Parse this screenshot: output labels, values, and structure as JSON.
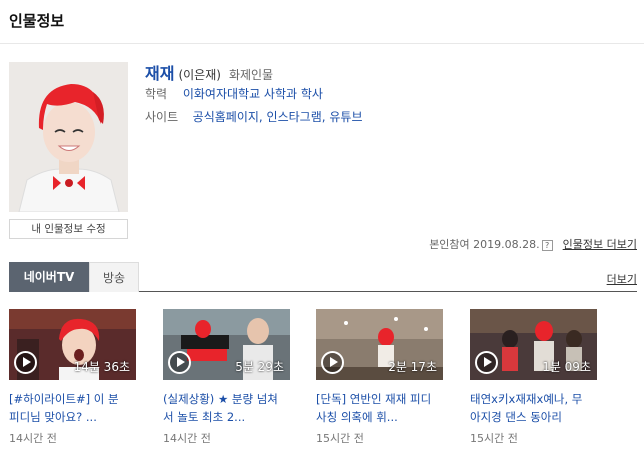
{
  "header": {
    "title": "인물정보"
  },
  "profile": {
    "name": "재재",
    "real_name": "(이은재)",
    "category": "화제인물",
    "edit_button": "내 인물정보 수정",
    "education": {
      "label": "학력",
      "value": "이화여자대학교 사학과 학사"
    },
    "site": {
      "label": "사이트",
      "links": [
        "공식홈페이지",
        "인스타그램",
        "유튜브"
      ]
    },
    "meta": {
      "verified_text": "본인참여 2019.08.28.",
      "help_glyph": "?",
      "more_link": "인물정보 더보기"
    }
  },
  "tabs": {
    "items": [
      {
        "label": "네이버TV",
        "active": true
      },
      {
        "label": "방송",
        "active": false
      }
    ],
    "more_link": "더보기"
  },
  "videos": [
    {
      "duration": "14분 36초",
      "title_line1": "[#하이라이트#] 이 분",
      "title_line2": "피디님 맞아요? ...",
      "time": "14시간 전",
      "bg": "#5a2b2b",
      "accent": "#e8242b"
    },
    {
      "duration": "5분 29초",
      "title_line1": "(실제상황) ★ 분량 넘쳐",
      "title_line2": "서 놀토 최초 2...",
      "time": "14시간 전",
      "bg": "#6a7378",
      "accent": "#f2e04a"
    },
    {
      "duration": "2분 17초",
      "title_line1": "[단독] 연반인 재재 피디",
      "title_line2": "사칭 의혹에 휘...",
      "time": "15시간 전",
      "bg": "#8a7c6e",
      "accent": "#c9bfb2"
    },
    {
      "duration": "1분 09초",
      "title_line1": "태연x키x재재x예나, 무",
      "title_line2": "아지경 댄스 동아리",
      "time": "15시간 전",
      "bg": "#4a3a3a",
      "accent": "#d9383c"
    }
  ],
  "colors": {
    "link_blue": "#1c4fa8",
    "tab_active_bg": "#5b6470",
    "hair_red": "#e8242b"
  }
}
